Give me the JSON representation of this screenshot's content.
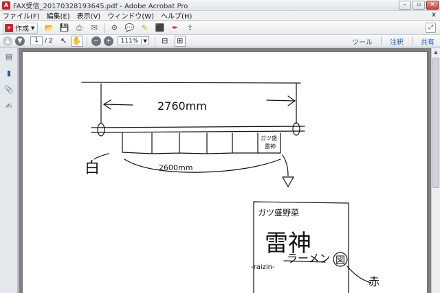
{
  "window": {
    "title": "FAX受信_20170328193645.pdf - Adobe Acrobat Pro",
    "controls": [
      "minimize",
      "restore",
      "close"
    ]
  },
  "menu": [
    "ファイル(F)",
    "編集(E)",
    "表示(V)",
    "ウィンドウ(W)",
    "ヘルプ(H)"
  ],
  "menu_close": "x",
  "toolbar": {
    "create_label": "作成",
    "icons": [
      "open-icon",
      "save-icon",
      "print-icon",
      "email-icon",
      "settings-icon",
      "comment-icon",
      "highlight-icon",
      "export-pdf-icon",
      "sign-icon",
      "share-icon"
    ]
  },
  "nav": {
    "current_page": "1",
    "total_pages": "/ 2",
    "zoom": "111%"
  },
  "panels": {
    "tools": "ツール",
    "comment": "注釈",
    "share": "共有"
  },
  "sidebar_icons": [
    "pages-icon",
    "bookmarks-icon",
    "attachments-icon",
    "signatures-icon"
  ],
  "document": {
    "dimension_top": "2760mm",
    "dimension_bottom": "2600mm",
    "label_white": "白",
    "label_red": "赤",
    "signboard_small": "ガツ盛野菜",
    "signboard_main": "雷神",
    "signboard_sub": "ラーメン",
    "signboard_circle": "図",
    "signboard_romaji": "-raizin-",
    "box_small_text": "ガツ盛",
    "box_small_text2": "雷神"
  },
  "colors": {
    "brand": "#c0282d",
    "link": "#2a5fa0",
    "viewport_bg": "#7f8185"
  }
}
